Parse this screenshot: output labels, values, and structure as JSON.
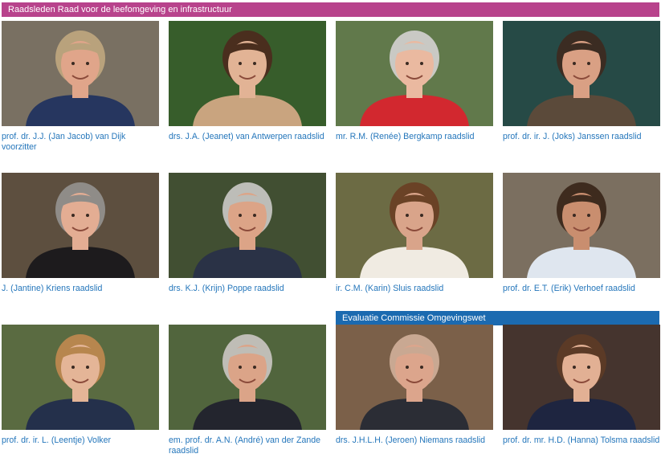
{
  "sections": {
    "raad": {
      "title": "Raadsleden Raad voor de leefomgeving en infrastructuur",
      "color": "#b8438c"
    },
    "evaluatie": {
      "title": "Evaluatie Commissie Omgevingswet",
      "color": "#1b6ab0"
    }
  },
  "link_color": "#2476bb",
  "members": [
    {
      "name": "prof. dr. J.J. (Jan Jacob) van Dijk voorzitter",
      "bg": "#8a8070",
      "shirt": "#26365f",
      "skin": "#e0a58a",
      "hair": "#b9a27c"
    },
    {
      "name": "drs. J.A. (Jeanet) van Antwerpen raadslid",
      "bg": "#3f6a32",
      "shirt": "#c9a47f",
      "skin": "#e2b395",
      "hair": "#4a2e1e"
    },
    {
      "name": "mr. R.M. (Renée) Bergkamp raadslid",
      "bg": "#6f8a56",
      "shirt": "#d2282f",
      "skin": "#eab9a0",
      "hair": "#c9c9c4"
    },
    {
      "name": "prof. dr. ir. J. (Joks) Janssen raadslid",
      "bg": "#2c5550",
      "shirt": "#5b4a3a",
      "skin": "#d9a084",
      "hair": "#3b2c22"
    },
    {
      "name": "J. (Jantine) Kriens raadslid",
      "bg": "#6a5a48",
      "shirt": "#1d1b1d",
      "skin": "#e3ad93",
      "hair": "#8f8c88"
    },
    {
      "name": "drs. K.J. (Krijn) Poppe raadslid",
      "bg": "#4a5a3a",
      "shirt": "#2a3246",
      "skin": "#dca487",
      "hair": "#bdbdb8"
    },
    {
      "name": "ir. C.M. (Karin) Sluis raadslid",
      "bg": "#7c7a4e",
      "shirt": "#f0ebe2",
      "skin": "#d9a48a",
      "hair": "#6a4226"
    },
    {
      "name": "prof. dr. E.T. (Erik) Verhoef raadslid",
      "bg": "#8c7f6e",
      "shirt": "#dfe6ef",
      "skin": "#c98e6f",
      "hair": "#3e2b1e"
    },
    {
      "name": "prof. dr. ir. L. (Leentje) Volker",
      "bg": "#677a4b",
      "shirt": "#24304b",
      "skin": "#e4b597",
      "hair": "#b7864e"
    },
    {
      "name": "em. prof. dr. A.N. (André) van der Zande raadslid",
      "bg": "#5d7346",
      "shirt": "#23252e",
      "skin": "#dba488",
      "hair": "#bfbdb6"
    },
    {
      "name": "drs. J.H.L.H. (Jeroen) Niemans raadslid",
      "bg": "#8c6e54",
      "shirt": "#2b2d35",
      "skin": "#dca58c",
      "hair": "#c9a892"
    },
    {
      "name": "prof. dr. mr. H.D. (Hanna) Tolsma raadslid",
      "bg": "#4f3c35",
      "shirt": "#1e2540",
      "skin": "#e2b094",
      "hair": "#5b3a26"
    }
  ]
}
